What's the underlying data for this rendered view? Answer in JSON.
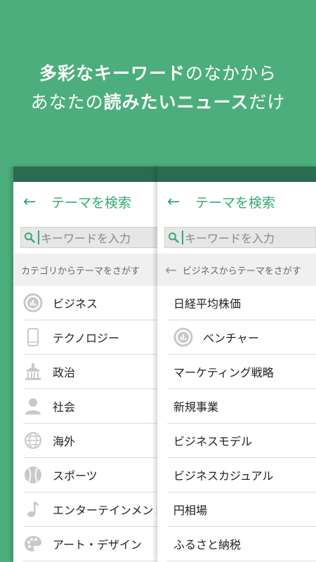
{
  "headline": {
    "line1": [
      {
        "text": "多彩なキーワード",
        "bold": true
      },
      {
        "text": "のなかから",
        "bold": false
      }
    ],
    "line2": [
      {
        "text": "あなたの",
        "bold": false
      },
      {
        "text": "読みたいニュース",
        "bold": true
      },
      {
        "text": "だけ",
        "bold": false
      }
    ]
  },
  "left_panel": {
    "title": "テーマを検索",
    "search_placeholder": "キーワードを入力",
    "section_label": "カテゴリからテーマをさがす",
    "items": [
      {
        "label": "ビジネス",
        "icon": "business-chart-icon"
      },
      {
        "label": "テクノロジー",
        "icon": "smartphone-icon"
      },
      {
        "label": "政治",
        "icon": "parliament-building-icon"
      },
      {
        "label": "社会",
        "icon": "person-icon"
      },
      {
        "label": "海外",
        "icon": "globe-icon"
      },
      {
        "label": "スポーツ",
        "icon": "baseball-icon"
      },
      {
        "label": "エンターテインメント",
        "icon": "music-note-icon"
      },
      {
        "label": "アート・デザイン",
        "icon": "palette-icon"
      }
    ]
  },
  "right_panel": {
    "title": "テーマを検索",
    "search_placeholder": "キーワードを入力",
    "section_label": "ビジネスからテーマをさがす",
    "items": [
      {
        "label": "日経平均株価",
        "icon": ""
      },
      {
        "label": "ベンチャー",
        "icon": "business-chart-icon"
      },
      {
        "label": "マーケティング戦略",
        "icon": ""
      },
      {
        "label": "新規事業",
        "icon": ""
      },
      {
        "label": "ビジネスモデル",
        "icon": ""
      },
      {
        "label": "ビジネスカジュアル",
        "icon": ""
      },
      {
        "label": "円相場",
        "icon": ""
      },
      {
        "label": "ふるさと納税",
        "icon": ""
      }
    ]
  },
  "colors": {
    "brand": "#4cae7c",
    "dark_bar": "#2b6b51",
    "accent": "#3aa873",
    "icon_gray": "#c9c9c9"
  }
}
